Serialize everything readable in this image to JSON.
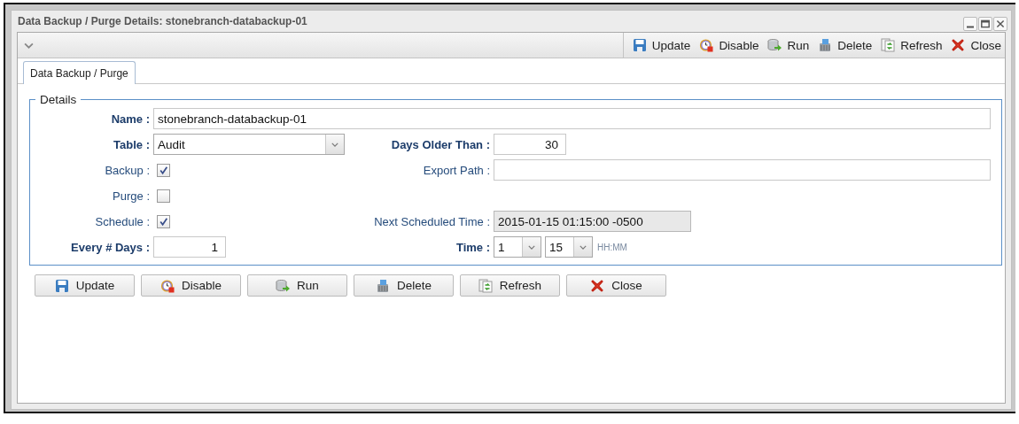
{
  "window": {
    "title": "Data Backup / Purge Details: stonebranch-databackup-01"
  },
  "toolbar": {
    "buttons": [
      {
        "label": "Update"
      },
      {
        "label": "Disable"
      },
      {
        "label": "Run"
      },
      {
        "label": "Delete"
      },
      {
        "label": "Refresh"
      },
      {
        "label": "Close"
      }
    ]
  },
  "tabs": [
    {
      "label": "Data Backup / Purge",
      "selected": true
    }
  ],
  "details": {
    "legend": "Details",
    "rows": [
      {
        "fields": [
          {
            "label": "Name :",
            "required": true,
            "kind": "text",
            "value": "stonebranch-databackup-01"
          }
        ]
      },
      {
        "fields": [
          {
            "label": "Table :",
            "required": true,
            "kind": "select",
            "value": "Audit"
          },
          {
            "label": "Days Older Than :",
            "required": true,
            "kind": "number",
            "value": "30"
          }
        ]
      },
      {
        "fields": [
          {
            "label": "Backup :",
            "required": false,
            "kind": "checkbox",
            "checked": true
          },
          {
            "label": "Export Path :",
            "required": false,
            "kind": "text"
          }
        ]
      },
      {
        "fields": [
          {
            "label": "Purge :",
            "required": false,
            "kind": "checkbox",
            "checked": false
          }
        ]
      },
      {
        "fields": [
          {
            "label": "Schedule :",
            "required": false,
            "kind": "checkbox",
            "checked": true
          },
          {
            "label": "Next Scheduled Time :",
            "required": false,
            "kind": "readonly",
            "value": "2015-01-15 01:15:00 -0500"
          }
        ]
      },
      {
        "fields": [
          {
            "label": "Every # Days :",
            "required": true,
            "kind": "number",
            "value": "1"
          },
          {
            "label": "Time :",
            "required": true,
            "kind": "time",
            "hour": "1",
            "minute": "15",
            "hint": "HH:MM"
          }
        ]
      }
    ]
  },
  "buttons": [
    {
      "label": "Update"
    },
    {
      "label": "Disable"
    },
    {
      "label": "Run"
    },
    {
      "label": "Delete"
    },
    {
      "label": "Refresh"
    },
    {
      "label": "Close"
    }
  ]
}
